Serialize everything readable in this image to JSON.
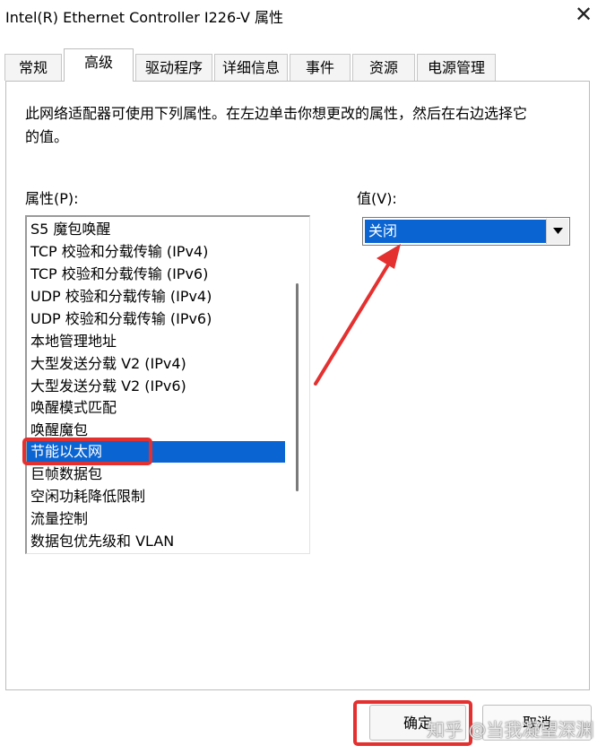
{
  "window": {
    "title": "Intel(R) Ethernet Controller I226-V 属性",
    "close_glyph": "✕"
  },
  "tabs": [
    {
      "label": "常规",
      "active": false
    },
    {
      "label": "高级",
      "active": true
    },
    {
      "label": "驱动程序",
      "active": false
    },
    {
      "label": "详细信息",
      "active": false
    },
    {
      "label": "事件",
      "active": false
    },
    {
      "label": "资源",
      "active": false
    },
    {
      "label": "电源管理",
      "active": false
    }
  ],
  "advanced": {
    "description": "此网络适配器可使用下列属性。在左边单击你想更改的属性，然后在右边选择它的值。",
    "property_label": "属性(P):",
    "value_label": "值(V):",
    "properties": [
      "S5 魔包唤醒",
      "TCP 校验和分载传输 (IPv4)",
      "TCP 校验和分载传输 (IPv6)",
      "UDP 校验和分载传输 (IPv4)",
      "UDP 校验和分载传输 (IPv6)",
      "本地管理地址",
      "大型发送分载 V2 (IPv4)",
      "大型发送分载 V2 (IPv6)",
      "唤醒模式匹配",
      "唤醒魔包",
      "节能以太网",
      "巨帧数据包",
      "空闲功耗降低限制",
      "流量控制",
      "数据包优先级和 VLAN"
    ],
    "selected_property": "节能以太网",
    "selected_value": "关闭"
  },
  "buttons": {
    "ok_label": "确定",
    "cancel_label": "取消"
  },
  "watermark": "知乎 @当我凝望深渊",
  "colors": {
    "selection": "#0a64d2",
    "annotation": "#e53030"
  }
}
